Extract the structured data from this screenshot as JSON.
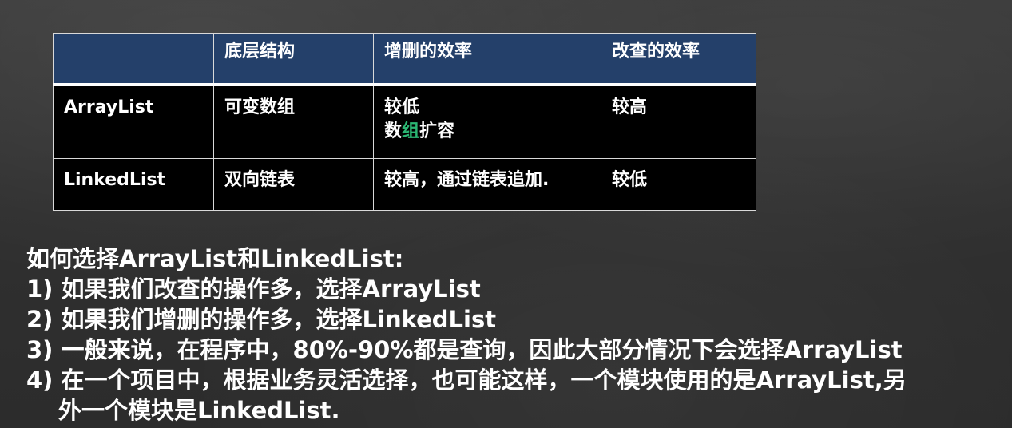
{
  "table": {
    "headers": [
      "",
      "底层结构",
      "增删的效率",
      "改查的效率"
    ],
    "rows": [
      {
        "name": "ArrayList",
        "structure": "可变数组",
        "add_delete_line1": "较低",
        "add_delete_line2_a": "数",
        "add_delete_line2_b": "组",
        "add_delete_line2_c": "扩容",
        "query": "较高"
      },
      {
        "name": "LinkedList",
        "structure": "双向链表",
        "add_delete_line1": "较高，通过链表追加.",
        "query": "较低"
      }
    ]
  },
  "summary": {
    "title": "如何选择ArrayList和LinkedList:",
    "items": [
      "1) 如果我们改查的操作多，选择ArrayList",
      "2) 如果我们增删的操作多，选择LinkedList",
      "3) 一般来说，在程序中，80%-90%都是查询，因此大部分情况下会选择ArrayList",
      "4) 在一个项目中，根据业务灵活选择，也可能这样，一个模块使用的是ArrayList,另"
    ],
    "item4_continuation": "外一个模块是LinkedList."
  },
  "colors": {
    "header_bg": "#24406a",
    "cell_bg": "#000000",
    "board_bg": "#333333",
    "cursor_accent": "#2bb673"
  }
}
